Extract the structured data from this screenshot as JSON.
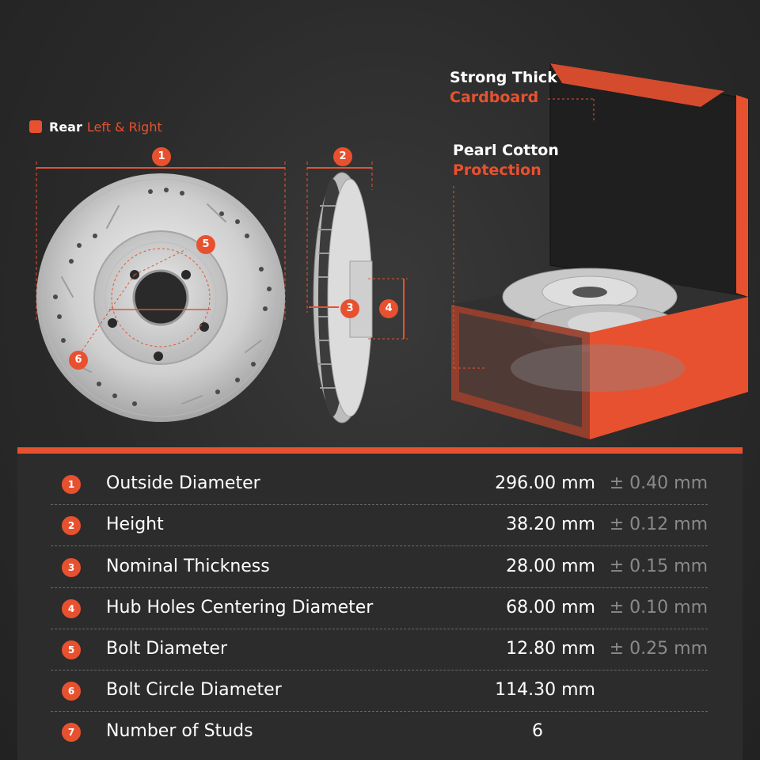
{
  "header": {
    "position_prefix": "Rear",
    "position_suffix": "Left & Right"
  },
  "callouts": {
    "cardboard_line1": "Strong Thick",
    "cardboard_line2": "Cardboard",
    "pearl_line1": "Pearl Cotton",
    "pearl_line2": "Protection"
  },
  "markers": [
    "1",
    "2",
    "3",
    "4",
    "5",
    "6"
  ],
  "specs": [
    {
      "num": "1",
      "name": "Outside Diameter",
      "value": "296.00 mm",
      "tolerance": "± 0.40 mm"
    },
    {
      "num": "2",
      "name": "Height",
      "value": "38.20 mm",
      "tolerance": "± 0.12 mm"
    },
    {
      "num": "3",
      "name": "Nominal Thickness",
      "value": "28.00 mm",
      "tolerance": "± 0.15 mm"
    },
    {
      "num": "4",
      "name": "Hub Holes Centering Diameter",
      "value": "68.00 mm",
      "tolerance": "± 0.10 mm"
    },
    {
      "num": "5",
      "name": "Bolt Diameter",
      "value": "12.80 mm",
      "tolerance": "± 0.25 mm"
    },
    {
      "num": "6",
      "name": "Bolt Circle Diameter",
      "value": "114.30 mm",
      "tolerance": ""
    },
    {
      "num": "7",
      "name": "Number of Studs",
      "value": "6",
      "tolerance": ""
    }
  ],
  "colors": {
    "accent": "#e8512f",
    "background": "#2a2a2a",
    "text": "#ffffff",
    "muted": "#8a8a8a"
  }
}
